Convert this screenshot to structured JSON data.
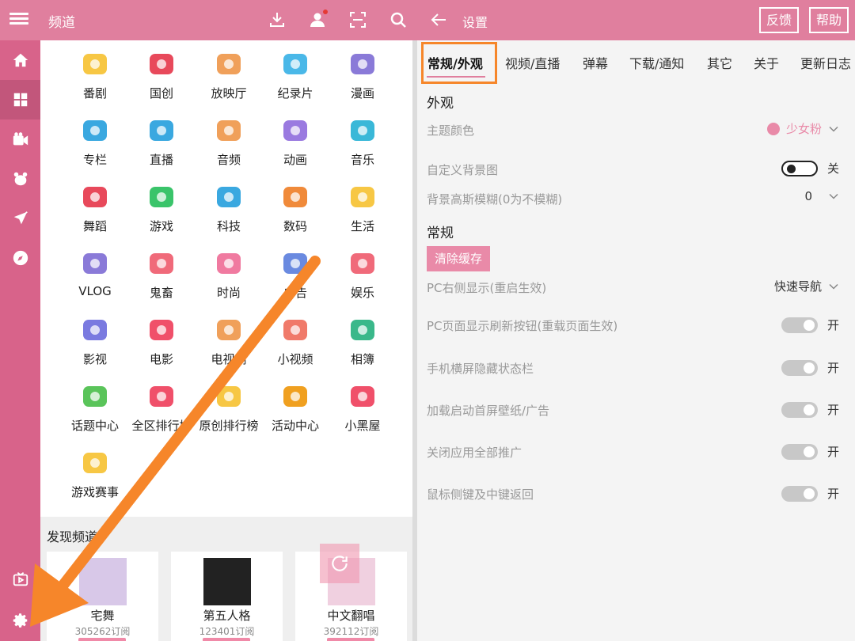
{
  "header": {
    "left_title": "频道",
    "right_title": "设置",
    "feedback_label": "反馈",
    "help_label": "帮助"
  },
  "channels": [
    {
      "label": "番剧",
      "icon": "tv-icon",
      "color": "#f7c744"
    },
    {
      "label": "国创",
      "icon": "peach-icon",
      "color": "#e8495b"
    },
    {
      "label": "放映厅",
      "icon": "film-reel-icon",
      "color": "#f0a05a"
    },
    {
      "label": "纪录片",
      "icon": "whale-icon",
      "color": "#4ab8e8"
    },
    {
      "label": "漫画",
      "icon": "beret-icon",
      "color": "#8a7ad8"
    },
    {
      "label": "专栏",
      "icon": "article-icon",
      "color": "#3aa8e0"
    },
    {
      "label": "直播",
      "icon": "camera-icon",
      "color": "#3aa8e0"
    },
    {
      "label": "音频",
      "icon": "bird-icon",
      "color": "#f0a05a"
    },
    {
      "label": "动画",
      "icon": "play-box-icon",
      "color": "#9a7ae0"
    },
    {
      "label": "音乐",
      "icon": "headphones-icon",
      "color": "#3ab8d8"
    },
    {
      "label": "舞蹈",
      "icon": "fan-icon",
      "color": "#e8495b"
    },
    {
      "label": "游戏",
      "icon": "creeper-icon",
      "color": "#3ac46a"
    },
    {
      "label": "科技",
      "icon": "ufo-icon",
      "color": "#3aa8e0"
    },
    {
      "label": "数码",
      "icon": "photo-camera-icon",
      "color": "#f08a3a"
    },
    {
      "label": "生活",
      "icon": "duck-icon",
      "color": "#f7c744"
    },
    {
      "label": "VLOG",
      "icon": "vlog-camera-icon",
      "color": "#8a7ad8"
    },
    {
      "label": "鬼畜",
      "icon": "clown-icon",
      "color": "#f06a7a"
    },
    {
      "label": "时尚",
      "icon": "dress-icon",
      "color": "#f07aa0"
    },
    {
      "label": "广告",
      "icon": "megaphone-icon",
      "color": "#6a8ae0"
    },
    {
      "label": "娱乐",
      "icon": "magic-wand-icon",
      "color": "#f06a7a"
    },
    {
      "label": "影视",
      "icon": "clapper-icon",
      "color": "#7a7ae0"
    },
    {
      "label": "电影",
      "icon": "3d-glasses-icon",
      "color": "#f0506a"
    },
    {
      "label": "电视剧",
      "icon": "sofa-icon",
      "color": "#f0a05a"
    },
    {
      "label": "小视频",
      "icon": "short-video-icon",
      "color": "#f07a6a"
    },
    {
      "label": "相簿",
      "icon": "picture-icon",
      "color": "#3ab88a"
    },
    {
      "label": "话题中心",
      "icon": "chat-bubble-icon",
      "color": "#5ac45a"
    },
    {
      "label": "全区排行榜",
      "icon": "trophy-icon",
      "color": "#f0506a"
    },
    {
      "label": "原创排行榜",
      "icon": "diamond-badge-icon",
      "color": "#f7c744"
    },
    {
      "label": "活动中心",
      "icon": "flag-icon",
      "color": "#f0a020"
    },
    {
      "label": "小黑屋",
      "icon": "blocked-icon",
      "color": "#f0506a"
    },
    {
      "label": "游戏赛事",
      "icon": "star-cup-icon",
      "color": "#f7c744"
    }
  ],
  "discover": {
    "title": "发现频道",
    "cards": [
      {
        "name": "宅舞",
        "subs": "305262订阅",
        "thumb_color": "#c8b8e0"
      },
      {
        "name": "第五人格",
        "subs": "123401订阅",
        "thumb_color": "#222222"
      },
      {
        "name": "中文翻唱",
        "subs": "392112订阅",
        "thumb_color": "#f0c8d8"
      }
    ]
  },
  "settings": {
    "tabs": [
      "常规/外观",
      "视频/直播",
      "弹幕",
      "下载/通知",
      "其它",
      "关于",
      "更新日志"
    ],
    "active_tab": "常规/外观",
    "section_appearance": "外观",
    "theme_color_label": "主题颜色",
    "theme_color_value": "少女粉",
    "theme_color_hex": "#e98aa8",
    "custom_bg_label": "自定义背景图",
    "custom_bg_state": "关",
    "blur_label": "背景高斯模糊(0为不模糊)",
    "blur_value": "0",
    "section_general": "常规",
    "clear_cache_label": "清除缓存",
    "pc_right_label": "PC右侧显示(重启生效)",
    "pc_right_value": "快速导航",
    "toggles": [
      {
        "label": "PC页面显示刷新按钮(重载页面生效)",
        "state": "开"
      },
      {
        "label": "手机横屏隐藏状态栏",
        "state": "开"
      },
      {
        "label": "加载启动首屏壁纸/广告",
        "state": "开"
      },
      {
        "label": "关闭应用全部推广",
        "state": "开"
      },
      {
        "label": "鼠标侧键及中键返回",
        "state": "开"
      }
    ]
  },
  "colors": {
    "header_pink": "#e07f9e",
    "rail_pink": "#d8638a",
    "annotation_orange": "#f6862a"
  }
}
